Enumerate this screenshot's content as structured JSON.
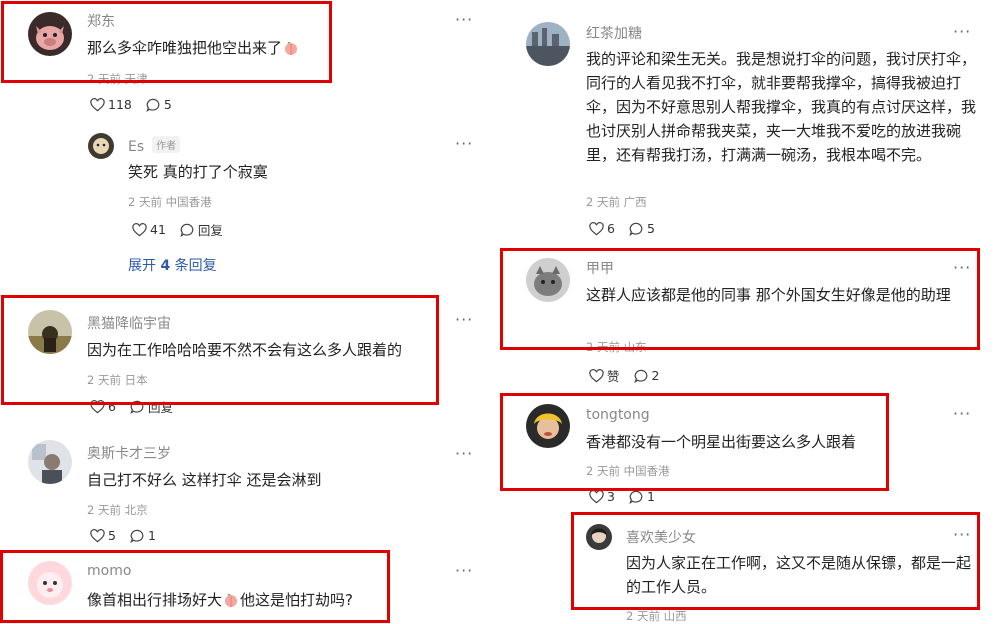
{
  "left": {
    "c1": {
      "user": "郑东",
      "text": "那么多伞咋唯独把他空出来了",
      "meta": "2 天前 天津",
      "likes": "118",
      "replies": "5"
    },
    "c1r": {
      "user": "Es",
      "tag": "作者",
      "text": "笑死 真的打了个寂寞",
      "meta": "2 天前 中国香港",
      "likes": "41",
      "reply": "回复"
    },
    "expand": {
      "pre": "展开 ",
      "num": "4",
      "post": " 条回复"
    },
    "c2": {
      "user": "黑猫降临宇宙",
      "text": "因为在工作哈哈哈要不然不会有这么多人跟着的",
      "meta": "2 天前 日本",
      "likes": "6",
      "reply": "回复"
    },
    "c3": {
      "user": "奥斯卡才三岁",
      "text": "自己打不好么 这样打伞 还是会淋到",
      "meta": "2 天前 北京",
      "likes": "5",
      "replies": "1"
    },
    "c4": {
      "user": "momo",
      "text_a": "像首相出行排场好大",
      "text_b": "他这是怕打劫吗?"
    }
  },
  "right": {
    "c1": {
      "user": "红茶加糖",
      "text": "我的评论和梁生无关。我是想说打伞的问题，我讨厌打伞，同行的人看见我不打伞，就非要帮我撑伞，搞得我被迫打伞，因为不好意思别人帮我撑伞，我真的有点讨厌这样，我也讨厌别人拼命帮我夹菜，夹一大堆我不爱吃的放进我碗里，还有帮我打汤，打满满一碗汤，我根本喝不完。",
      "meta": "2 天前 广西",
      "likes": "6",
      "replies": "5"
    },
    "c2": {
      "user": "甲甲",
      "text": "这群人应该都是他的同事 那个外国女生好像是他的助理",
      "meta": "2 天前 山东",
      "likes": "赞",
      "replies": "2"
    },
    "c3": {
      "user": "tongtong",
      "text": "香港都没有一个明星出街要这么多人跟着",
      "meta": "2 天前 中国香港",
      "likes": "3",
      "replies": "1"
    },
    "c3r": {
      "user": "喜欢美少女",
      "text": "因为人家正在工作啊，这又不是随从保镖，都是一起的工作人员。",
      "meta": "2 天前 山西"
    }
  },
  "more_label": "···",
  "colors": {
    "highlight": "#e00000",
    "link": "#2f5aa8"
  }
}
